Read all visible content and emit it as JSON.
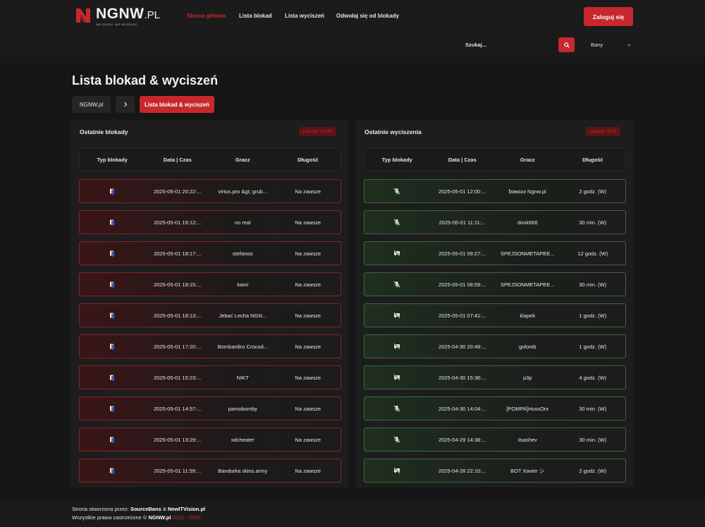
{
  "brand": {
    "name": "NGNW",
    "suffix": ".PL",
    "tagline": "NIE GRASZ, NIE WYGRASZ",
    "accent": "#c6282d"
  },
  "nav": {
    "items": [
      {
        "label": "Strona główna",
        "active": true
      },
      {
        "label": "Lista blokad",
        "active": false
      },
      {
        "label": "Lista wyciszeń",
        "active": false
      },
      {
        "label": "Odwołaj się od blokady",
        "active": false
      }
    ],
    "login_label": "Zaloguj się"
  },
  "search": {
    "placeholder": "Szukaj...",
    "icon": "search-icon",
    "type_selected": "Bany"
  },
  "page": {
    "title": "Lista blokad & wyciszeń",
    "breadcrumb": {
      "home": "NGNW.pl",
      "separator_icon": "chevron-right-icon",
      "current": "Lista blokad & wyciszeń"
    }
  },
  "bans": {
    "title": "Ostatnie blokady",
    "total": "Łącznie: 13138",
    "columns": [
      "Typ blokady",
      "Data | Czas",
      "Gracz",
      "Długość"
    ],
    "rows": [
      {
        "date": "2025-05-01 20:22:...",
        "player": "virtus.pro &gt; grub...",
        "length": "Na zawsze"
      },
      {
        "date": "2025-05-01 19:12:...",
        "player": "no real",
        "length": "Na zawsze"
      },
      {
        "date": "2025-05-01 18:17:...",
        "player": "stefanoo",
        "length": "Na zawsze"
      },
      {
        "date": "2025-05-01 18:15:...",
        "player": "kami",
        "length": "Na zawsze"
      },
      {
        "date": "2025-05-01 18:13:...",
        "player": "Jebać Lecha NGN...",
        "length": "Na zawsze"
      },
      {
        "date": "2025-05-01 17:20:...",
        "player": "Bombardiro Crocod...",
        "length": "Na zawsze"
      },
      {
        "date": "2025-05-01 15:23:...",
        "player": "NIKT",
        "length": "Na zawsze"
      },
      {
        "date": "2025-05-01 14:57:...",
        "player": "pamobomby",
        "length": "Na zawsze"
      },
      {
        "date": "2025-05-01 13:29:...",
        "player": "xdcheater",
        "length": "Na zawsze"
      },
      {
        "date": "2025-05-01 11:59:...",
        "player": "Bandurka skins.army",
        "length": "Na zawsze"
      }
    ]
  },
  "mutes": {
    "title": "Ostatnie wyciszenia",
    "total": "Łącznie: 3724",
    "columns": [
      "Typ blokady",
      "Data | Czas",
      "Gracz",
      "Długość"
    ],
    "rows": [
      {
        "icon": "mic-off-icon",
        "date": "2025-05-01 12:00:...",
        "player": "ƀɑɴɑƨƨ Ngnw.pl",
        "length": "2 godz. (W)"
      },
      {
        "icon": "mic-off-icon",
        "date": "2025-05-01 11:11:...",
        "player": "donk666",
        "length": "30 min. (W)"
      },
      {
        "icon": "chat-off-icon",
        "date": "2025-05-01 09:27:...",
        "player": "SPEJSONMETAPEE...",
        "length": "12 godz. (W)"
      },
      {
        "icon": "mic-off-icon",
        "date": "2025-05-01 08:59:...",
        "player": "SPEJSONMETAPEE...",
        "length": "30 min. (W)"
      },
      {
        "icon": "chat-off-icon",
        "date": "2025-05-01 07:41:...",
        "player": "klapek",
        "length": "1 godz. (W)"
      },
      {
        "icon": "chat-off-icon",
        "date": "2025-04-30 20:48:...",
        "player": "golomb",
        "length": "1 godz. (W)"
      },
      {
        "icon": "chat-off-icon",
        "date": "2025-04-30 15:36:...",
        "player": "p3p",
        "length": "4 godz. (W)"
      },
      {
        "icon": "mic-off-icon",
        "date": "2025-04-30 14:04:...",
        "player": "[POMPA]HussOrx",
        "length": "30 min. (W)"
      },
      {
        "icon": "mic-off-icon",
        "date": "2025-04-29 14:38:...",
        "player": "iisashev",
        "length": "30 min. (W)"
      },
      {
        "icon": "chat-off-icon",
        "date": "2025-04-28 22:10:...",
        "player": "BOT Xavier シ",
        "length": "2 godz. (W)"
      }
    ]
  },
  "footer": {
    "line1_prefix": "Strona stworzona przez: ",
    "line1_a": "SourceBans",
    "line1_and": " & ",
    "line1_b": "NewITVision.pl",
    "line2_prefix": "Wszystkie prawa zastrzeżone © ",
    "line2_site": "NGNW.pl",
    "line2_years": " 2022 - 2025"
  }
}
